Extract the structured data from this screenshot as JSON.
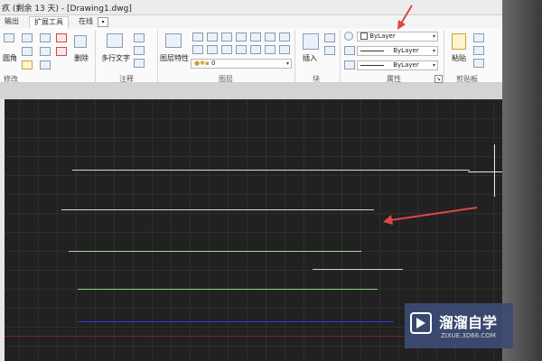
{
  "titlebar": {
    "title": "疚 (剩余 13 天) - [Drawing1.dwg]"
  },
  "tabs": [
    {
      "label": "输出",
      "active": false
    },
    {
      "label": "扩展工具",
      "active": true
    },
    {
      "label": "在线",
      "active": false
    }
  ],
  "ribbon": {
    "modify": {
      "label": "修改",
      "items": {
        "fillet": "圆角",
        "erase": "删除"
      }
    },
    "annotation": {
      "label": "注释",
      "items": {
        "mtext": "多行文字"
      }
    },
    "layers": {
      "label": "图层",
      "items": {
        "layer_properties": "图层特性",
        "layer_value": "0"
      }
    },
    "block": {
      "label": "块",
      "items": {
        "insert": "插入"
      }
    },
    "properties": {
      "label": "属性",
      "color": "ByLayer",
      "linetype": "ByLayer",
      "lineweight": "ByLayer"
    },
    "clipboard": {
      "label": "剪贴板",
      "items": {
        "paste": "粘贴"
      }
    }
  },
  "watermark": {
    "name": "溜溜自学",
    "url": "ZIXUE.3D66.COM"
  },
  "colors": {
    "canvas_bg": "#212121",
    "arrow": "#e04545",
    "line_white": "#d6d6d6",
    "line_green": "#9fd99a",
    "line_blue": "#2b3bd6",
    "line_red": "#7a2222"
  }
}
